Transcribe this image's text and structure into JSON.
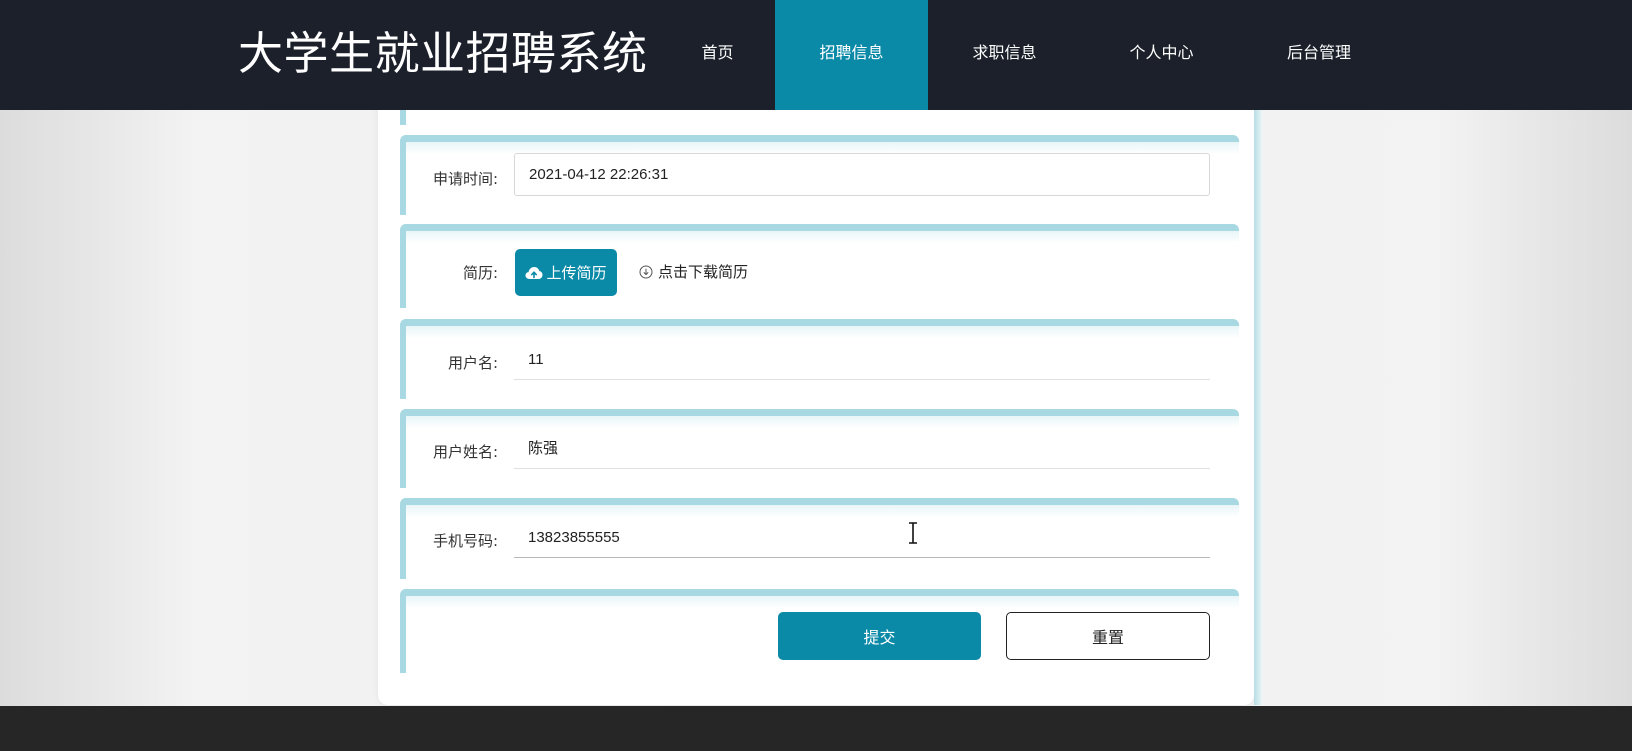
{
  "header": {
    "site_title": "大学生就业招聘系统",
    "nav": [
      {
        "label": "首页",
        "active": false
      },
      {
        "label": "招聘信息",
        "active": true
      },
      {
        "label": "求职信息",
        "active": false
      },
      {
        "label": "个人中心",
        "active": false
      },
      {
        "label": "后台管理",
        "active": false
      }
    ]
  },
  "form": {
    "apply_time": {
      "label": "申请时间:",
      "value": "2021-04-12 22:26:31"
    },
    "resume": {
      "label": "简历:",
      "upload_label": "上传简历",
      "upload_icon": "cloud-upload-icon",
      "download_label": "点击下载简历",
      "download_icon": "download-circle-icon"
    },
    "username": {
      "label": "用户名:",
      "value": "11"
    },
    "real_name": {
      "label": "用户姓名:",
      "value": "陈强"
    },
    "phone": {
      "label": "手机号码:",
      "value": "13823855555"
    },
    "submit_label": "提交",
    "reset_label": "重置"
  },
  "colors": {
    "header_bg": "#1b202b",
    "accent": "#0b8aa8",
    "row_border": "#a8d9e2",
    "footer_bg": "#262626"
  }
}
